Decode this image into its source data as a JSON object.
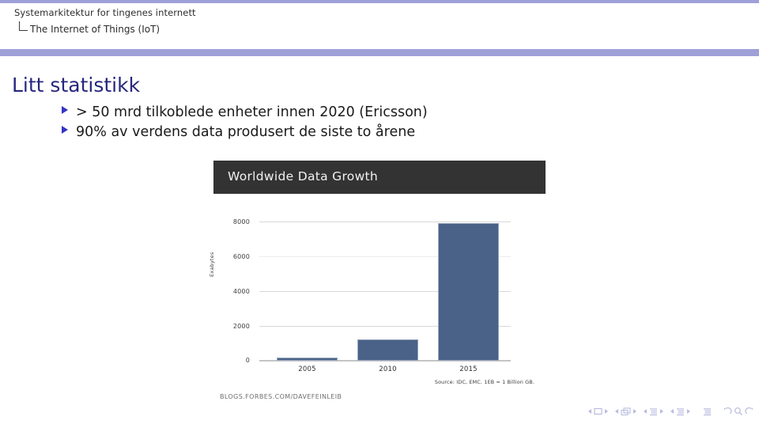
{
  "header": {
    "title": "Systemarkitektur for tingenes internett",
    "subtitle": "The Internet of Things (IoT)"
  },
  "slide": {
    "frame_title": "Litt statistikk",
    "bullets": [
      {
        "marker": "triangle-bullet-icon",
        "text": "> 50 mrd tilkoblede enheter innen 2020 (Ericsson)"
      },
      {
        "marker": "triangle-bullet-icon",
        "text": "90% av verdens data produsert de siste to årene"
      }
    ]
  },
  "chart_data": {
    "type": "bar",
    "title": "Worldwide Data Growth",
    "categories": [
      "2005",
      "2010",
      "2015"
    ],
    "values": [
      130,
      1200,
      7900
    ],
    "xlabel": "",
    "ylabel": "Exabytes",
    "ylim": [
      0,
      8000
    ],
    "yticks": [
      "0",
      "2000",
      "4000",
      "6000",
      "8000"
    ],
    "grid": true,
    "legend": "none",
    "bar_color": "#4a6287",
    "banner_color": "#333333",
    "source": "Source: IDC, EMC. 1EB = 1 Billion GB.",
    "watermark": "BLOGS.FORBES.COM/DAVEFEINLEIB"
  },
  "navigation": {
    "items": [
      {
        "name": "nav-slide",
        "icon": "slide-icon"
      },
      {
        "name": "nav-frame",
        "icon": "frames-icon"
      },
      {
        "name": "nav-subsection",
        "icon": "subsection-icon"
      },
      {
        "name": "nav-section",
        "icon": "section-icon"
      },
      {
        "name": "nav-presentation",
        "icon": "presentation-icon"
      }
    ],
    "back_icon": "back-arrow-icon",
    "search_icon": "search-icon",
    "forward_icon": "forward-arrow-icon"
  },
  "theme": {
    "accent": "#9fa0d8",
    "title_color": "#27277e",
    "bullet_color": "#3434c4"
  }
}
